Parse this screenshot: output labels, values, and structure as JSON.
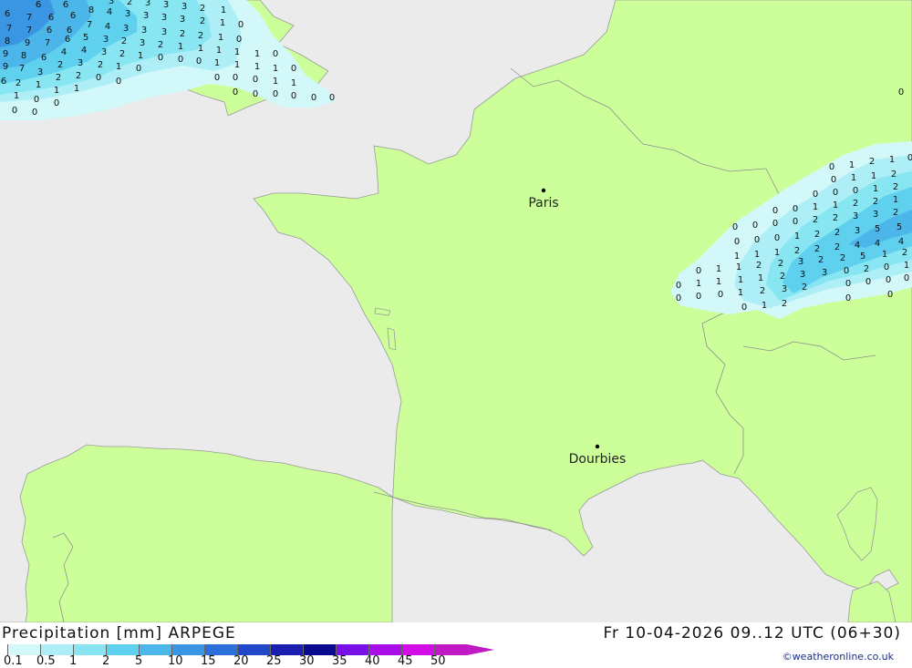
{
  "map": {
    "sea_color": "#ebebeb",
    "land_color": "#ccff99",
    "border_color": "#9a9a9a",
    "cities": [
      {
        "name": "Paris"
      },
      {
        "name": "Dourbies"
      }
    ]
  },
  "footer": {
    "title": "Precipitation [mm] ARPEGE",
    "datetime": "Fr 10-04-2026 09..12 UTC (06+30)",
    "credit": "©weatheronline.co.uk"
  },
  "legend": {
    "labels": [
      "0.1",
      "0.5",
      "1",
      "2",
      "5",
      "10",
      "15",
      "20",
      "25",
      "30",
      "35",
      "40",
      "45",
      "50"
    ],
    "colors": [
      "#d2f8fa",
      "#aeeff7",
      "#88e6f2",
      "#5fd1ef",
      "#4cb6ea",
      "#3a95e2",
      "#2b6fd8",
      "#2248c8",
      "#1a1fb0",
      "#0a0a90",
      "#7a10e8",
      "#a80ee8",
      "#d20ee6",
      "#c01ac4"
    ]
  }
}
